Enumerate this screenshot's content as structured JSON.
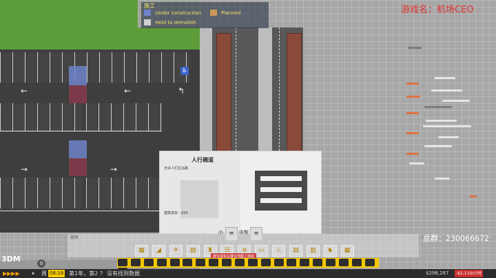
{
  "legend": {
    "title": "施工",
    "items": [
      {
        "label": "Under construction",
        "color": "#6f84c9"
      },
      {
        "label": "Planned",
        "color": "#c8965a"
      },
      {
        "label": "Hold to demolish",
        "color": "#d0d0d0"
      }
    ]
  },
  "watermark": {
    "game_name": "游戏名：机场CEO",
    "group": "总群：230066672"
  },
  "tooltip": {
    "title": "人行横道",
    "subtitle": "允许人们过马路",
    "cost": "建筑成本：$50"
  },
  "size_selector": {
    "small_label": "小",
    "medium_label": "中型"
  },
  "search_box": {
    "label": "搜索"
  },
  "hint_text": "按住鼠标左键在地图上拖动",
  "status_bar": {
    "day": "周",
    "time": "08:18",
    "date": "第1年，第2",
    "message": "没有找到数据",
    "money": "$298,287",
    "rate": "-$2,110/小时",
    "badge": "0",
    "speed_icons": [
      "play-icon",
      "fast-icon",
      "faster-icon",
      "fastest-icon"
    ]
  },
  "colors": {
    "toolbar": "#f4c800",
    "grass": "#5d9c3b",
    "accent_red": "#e23030"
  }
}
